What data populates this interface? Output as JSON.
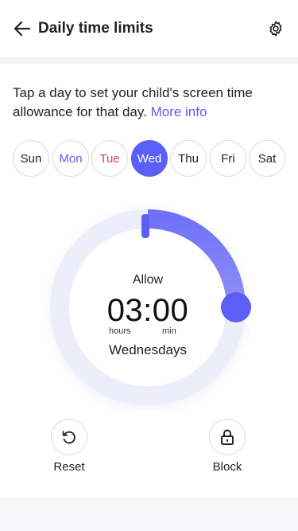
{
  "header": {
    "title": "Daily time limits",
    "back_icon": "arrow-left-icon",
    "settings_icon": "gear-icon"
  },
  "intro": {
    "text": "Tap a day to set your child's screen time allowance for that day. ",
    "link": "More info"
  },
  "days": [
    {
      "label": "Sun",
      "state": "normal"
    },
    {
      "label": "Mon",
      "state": "inactive"
    },
    {
      "label": "Tue",
      "state": "warn"
    },
    {
      "label": "Wed",
      "state": "selected"
    },
    {
      "label": "Thu",
      "state": "normal"
    },
    {
      "label": "Fri",
      "state": "normal"
    },
    {
      "label": "Sat",
      "state": "normal"
    }
  ],
  "dial": {
    "label": "Allow",
    "time": "03:00",
    "hours_unit": "hours",
    "minutes_unit": "min",
    "day": "Wednesdays",
    "fill_fraction": 0.25
  },
  "actions": {
    "reset": {
      "label": "Reset",
      "icon": "reset-icon"
    },
    "block": {
      "label": "Block",
      "icon": "lock-icon"
    }
  },
  "colors": {
    "accent": "#5b5ff6",
    "warn": "#d8404a",
    "track": "#eeeefb"
  }
}
